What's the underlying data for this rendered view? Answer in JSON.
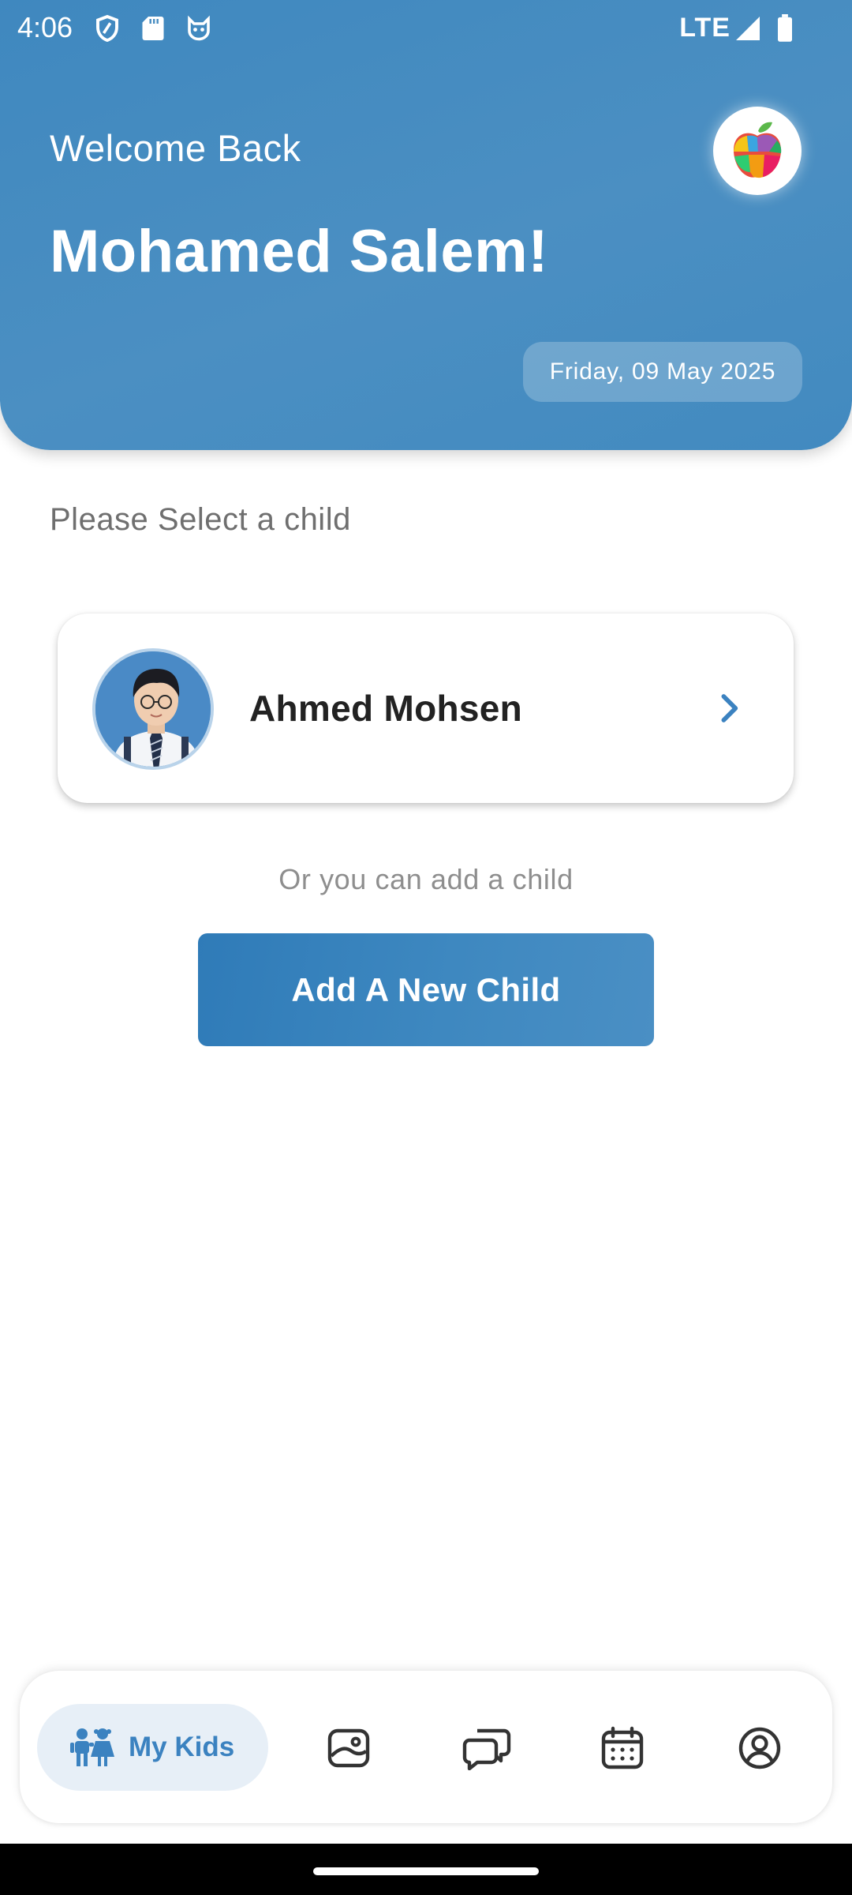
{
  "status_bar": {
    "time": "4:06",
    "network": "LTE",
    "icons": [
      "shield-icon",
      "sd-card-icon",
      "cat-face-icon",
      "signal-icon",
      "battery-icon"
    ]
  },
  "header": {
    "welcome": "Welcome Back",
    "user_name": "Mohamed Salem!",
    "date": "Friday, 09 May 2025",
    "logo_icon": "puzzle-apple-logo-icon",
    "background_color": "#4a8ec2"
  },
  "main": {
    "select_prompt": "Please Select a child",
    "children": [
      {
        "name": "Ahmed Mohsen",
        "avatar_icon": "child-photo-avatar"
      }
    ],
    "add_prompt": "Or you can add a child",
    "add_button_label": "Add A New Child"
  },
  "bottom_nav": {
    "items": [
      {
        "label": "My Kids",
        "icon": "kids-icon",
        "active": true
      },
      {
        "label": "",
        "icon": "gallery-icon",
        "active": false
      },
      {
        "label": "",
        "icon": "chat-icon",
        "active": false
      },
      {
        "label": "",
        "icon": "calendar-icon",
        "active": false
      },
      {
        "label": "",
        "icon": "profile-icon",
        "active": false
      }
    ]
  },
  "colors": {
    "accent": "#3b82c0",
    "active_nav_bg": "#e7eff7",
    "text_dark": "#222222",
    "text_muted": "#8e8e8e"
  }
}
